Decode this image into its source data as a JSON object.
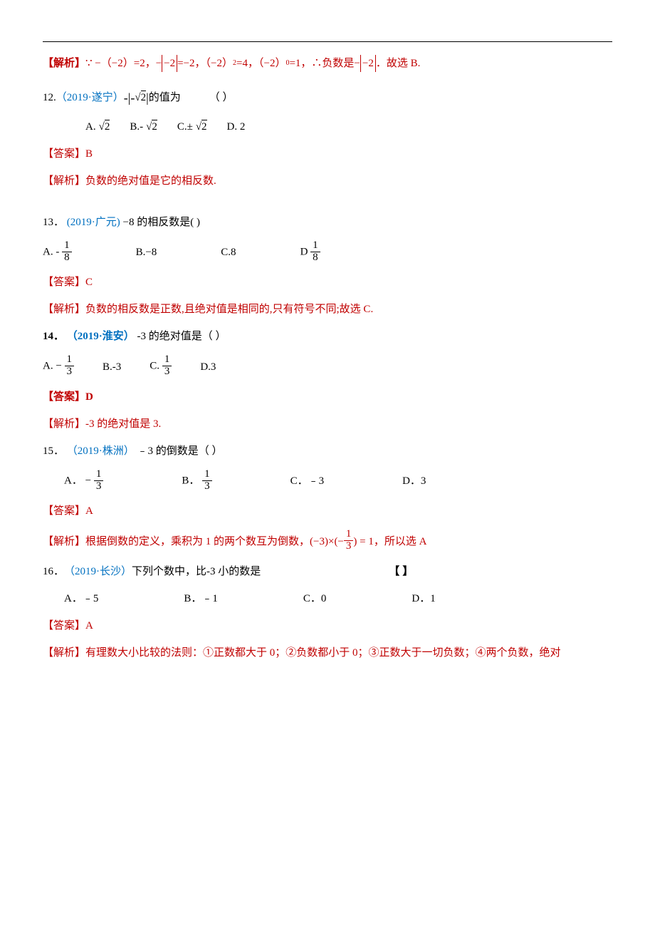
{
  "q11_ex": {
    "label": "【解析】",
    "body_1": "∵ −（−2）=2，",
    "body_2": "=−2，（−2）",
    "body_3": "=4，（−2）",
    "body_4": "=1，∴负数是",
    "body_5": "．故选 B.",
    "abs_expr": "−|−2|",
    "sup2": "2",
    "sup0": "0"
  },
  "q12": {
    "num": "12.",
    "source": "（2019·遂宁）",
    "stem_1": "-|-",
    "stem_2": "2",
    "stem_3": " |",
    "stem_4": "的值为",
    "blank": "（    ）",
    "opt_a_pre": "A.",
    "opt_b_pre": "B.-",
    "opt_c_pre": "C.±",
    "opt_d": "D.   2",
    "sqrt2": "2",
    "ans_label": "【答案】",
    "ans": "B",
    "ex_label": "【解析】",
    "ex": "负数的绝对值是它的相反数."
  },
  "q13": {
    "num": "13．",
    "source": "(2019·广元)",
    "stem": " −8 的相反数是(    )",
    "a": "A. -",
    "b": "B.−8",
    "c": "C.8",
    "d": "D",
    "frac_top": "1",
    "frac_bot": "8",
    "ans_label": "【答案】",
    "ans": "C",
    "ex_label": "【解析】",
    "ex": "负数的相反数是正数,且绝对值是相同的,只有符号不同;故选 C."
  },
  "q14": {
    "num": "14．",
    "source": "（2019·淮安）",
    "stem": "-3 的绝对值是（     ）",
    "a_pre": "A. −",
    "b": "B.-3",
    "c_pre": "C.",
    "d": "D.3",
    "frac_top": "1",
    "frac_bot": "3",
    "ans_label": "【答案】",
    "ans": "D",
    "ex_label": "【解析】",
    "ex": "-3 的绝对值是 3."
  },
  "q15": {
    "num": "15．",
    "source": "（2019·株洲）",
    "stem": "﹣3 的倒数是（    ）",
    "a_pre": "A．",
    "b_pre": "B．",
    "c": "C．﹣3",
    "d": "D．3",
    "neg": "−",
    "frac_top": "1",
    "frac_bot": "3",
    "ans_label": "【答案】",
    "ans": "A",
    "ex_label": "【解析】",
    "ex_1": "根据倒数的定义，乘积为 1 的两个数互为倒数，",
    "ex_formula_1": "(−3)×(−",
    "ex_formula_2": ") = 1",
    "ex_2": "，所以选 A"
  },
  "q16": {
    "num": "16．",
    "source": "（2019·长沙）",
    "stem": "下列个数中，比-3 小的数是",
    "blank": "【     】",
    "a": "A．﹣5",
    "b": "B．﹣1",
    "c": "C．0",
    "d": "D．1",
    "ans_label": "【答案】",
    "ans": "A",
    "ex_label": "【解析】",
    "ex": "有理数大小比较的法则：①正数都大于 0；②负数都小于 0；③正数大于一切负数；④两个负数，绝对"
  }
}
